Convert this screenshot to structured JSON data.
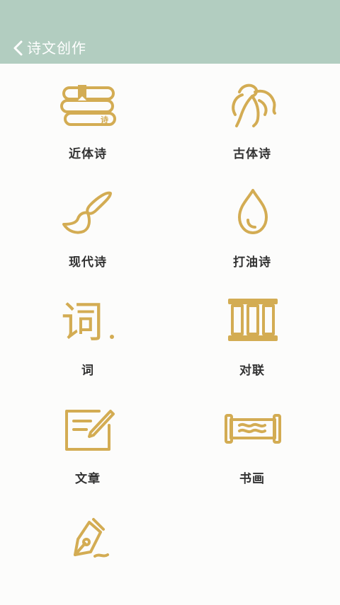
{
  "header": {
    "title": "诗文创作",
    "background": "#b2cdc0",
    "back_icon": "chevron-left-icon"
  },
  "accent_color": "#d3ac53",
  "items": [
    {
      "label": "近体诗",
      "icon": "books-icon"
    },
    {
      "label": "古体诗",
      "icon": "dancing-figure-icon"
    },
    {
      "label": "现代诗",
      "icon": "brush-icon"
    },
    {
      "label": "打油诗",
      "icon": "oil-drop-icon"
    },
    {
      "label": "词",
      "icon": "ci-character-icon"
    },
    {
      "label": "对联",
      "icon": "couplet-scrolls-icon"
    },
    {
      "label": "文章",
      "icon": "writing-board-icon"
    },
    {
      "label": "书画",
      "icon": "scroll-painting-icon"
    },
    {
      "label": "",
      "icon": "pen-nib-icon"
    }
  ]
}
